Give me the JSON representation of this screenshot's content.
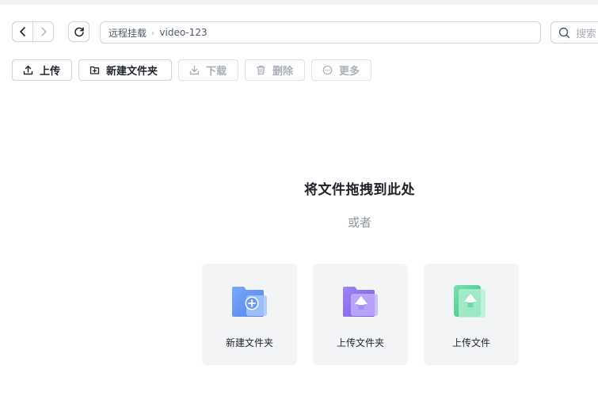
{
  "nav": {
    "back_icon": "chevron-left-icon",
    "forward_icon": "chevron-right-icon",
    "refresh_icon": "refresh-icon"
  },
  "breadcrumb": {
    "items": [
      "远程挂载",
      "video-123"
    ]
  },
  "search": {
    "placeholder": "搜索"
  },
  "toolbar": {
    "upload": "上传",
    "new_folder": "新建文件夹",
    "download": "下载",
    "delete": "删除",
    "more": "更多"
  },
  "dropzone": {
    "title": "将文件拖拽到此处",
    "or": "或者",
    "cards": [
      {
        "label": "新建文件夹",
        "icon": "new-folder-icon",
        "color": "#5b8def"
      },
      {
        "label": "上传文件夹",
        "icon": "upload-folder-icon",
        "color": "#8b6cf0"
      },
      {
        "label": "上传文件",
        "icon": "upload-file-icon",
        "color": "#3cc98a"
      }
    ]
  }
}
